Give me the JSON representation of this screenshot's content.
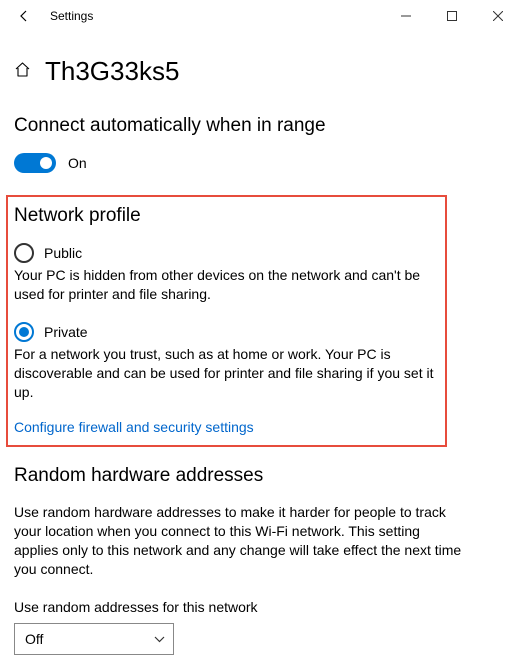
{
  "window": {
    "title": "Settings"
  },
  "header": {
    "page_title": "Th3G33ks5"
  },
  "connect_section": {
    "title": "Connect automatically when in range",
    "toggle_state": "On"
  },
  "profile_section": {
    "title": "Network profile",
    "public": {
      "label": "Public",
      "desc": "Your PC is hidden from other devices on the network and can't be used for printer and file sharing."
    },
    "private": {
      "label": "Private",
      "desc": "For a network you trust, such as at home or work. Your PC is discoverable and can be used for printer and file sharing if you set it up."
    },
    "firewall_link": "Configure firewall and security settings"
  },
  "random_section": {
    "title": "Random hardware addresses",
    "desc": "Use random hardware addresses to make it harder for people to track your location when you connect to this Wi-Fi network. This setting applies only to this network and any change will take effect the next time you connect.",
    "field_label": "Use random addresses for this network",
    "select_value": "Off"
  }
}
